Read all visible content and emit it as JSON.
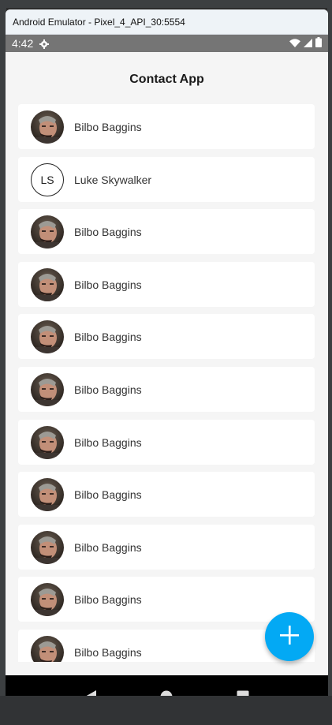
{
  "window": {
    "title": "Android Emulator - Pixel_4_API_30:5554"
  },
  "statusbar": {
    "time": "4:42"
  },
  "app": {
    "title": "Contact App"
  },
  "contacts": [
    {
      "name": "Bilbo Baggins",
      "avatar": "photo"
    },
    {
      "name": "Luke Skywalker",
      "avatar": "initials",
      "initials": "LS"
    },
    {
      "name": "Bilbo Baggins",
      "avatar": "photo"
    },
    {
      "name": "Bilbo Baggins",
      "avatar": "photo"
    },
    {
      "name": "Bilbo Baggins",
      "avatar": "photo"
    },
    {
      "name": "Bilbo Baggins",
      "avatar": "photo"
    },
    {
      "name": "Bilbo Baggins",
      "avatar": "photo"
    },
    {
      "name": "Bilbo Baggins",
      "avatar": "photo"
    },
    {
      "name": "Bilbo Baggins",
      "avatar": "photo"
    },
    {
      "name": "Bilbo Baggins",
      "avatar": "photo"
    },
    {
      "name": "Bilbo Baggins",
      "avatar": "photo"
    }
  ],
  "fab": {
    "icon": "plus-icon",
    "color": "#03a9f4"
  },
  "navbar": {
    "icons": [
      "back-icon",
      "home-icon",
      "recents-icon"
    ]
  }
}
